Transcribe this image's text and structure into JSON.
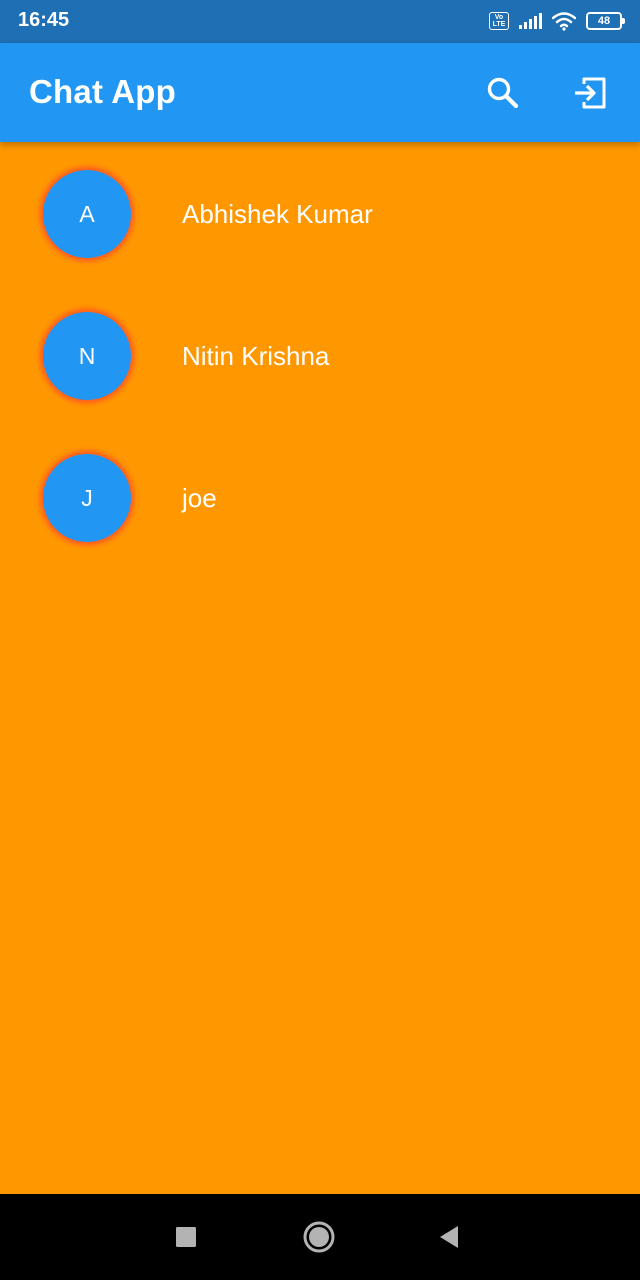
{
  "status_bar": {
    "time": "16:45",
    "volte_label": "Vo LTE",
    "battery_level": "48"
  },
  "app_bar": {
    "title": "Chat App",
    "search_icon": "search-icon",
    "logout_icon": "logout-icon"
  },
  "users": [
    {
      "initial": "A",
      "name": "Abhishek Kumar"
    },
    {
      "initial": "N",
      "name": "Nitin Krishna"
    },
    {
      "initial": "J",
      "name": "joe"
    }
  ],
  "nav_bar": {
    "recent_icon": "square-icon",
    "home_icon": "circle-icon",
    "back_icon": "triangle-back-icon"
  },
  "colors": {
    "background": "#FF9800",
    "app_bar": "#2196F3",
    "status_bar": "#1E6FB4",
    "avatar": "#2196F3",
    "avatar_glow": "#FF5722",
    "text": "#FFFFFF"
  }
}
